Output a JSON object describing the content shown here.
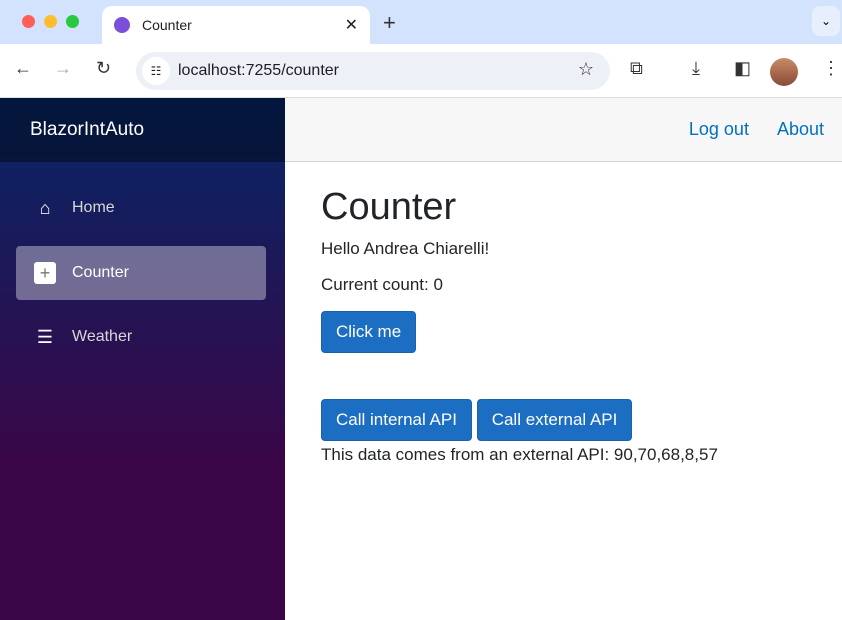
{
  "browser": {
    "tab_title": "Counter",
    "url": "localhost:7255/counter"
  },
  "sidebar": {
    "brand": "BlazorIntAuto",
    "items": [
      {
        "label": "Home",
        "icon": "home-icon"
      },
      {
        "label": "Counter",
        "icon": "plus-square-icon",
        "active": true
      },
      {
        "label": "Weather",
        "icon": "list-icon"
      }
    ]
  },
  "topbar": {
    "logout": "Log out",
    "about": "About"
  },
  "main": {
    "title": "Counter",
    "greeting": "Hello Andrea Chiarelli!",
    "count": "Current count: 0",
    "click_button": "Click me",
    "internal_button": "Call internal API",
    "external_button": "Call external API",
    "api_result": "This data comes from an external API: 90,70,68,8,57"
  },
  "colors": {
    "accent": "#1b6ec2",
    "link": "#0071c1"
  }
}
